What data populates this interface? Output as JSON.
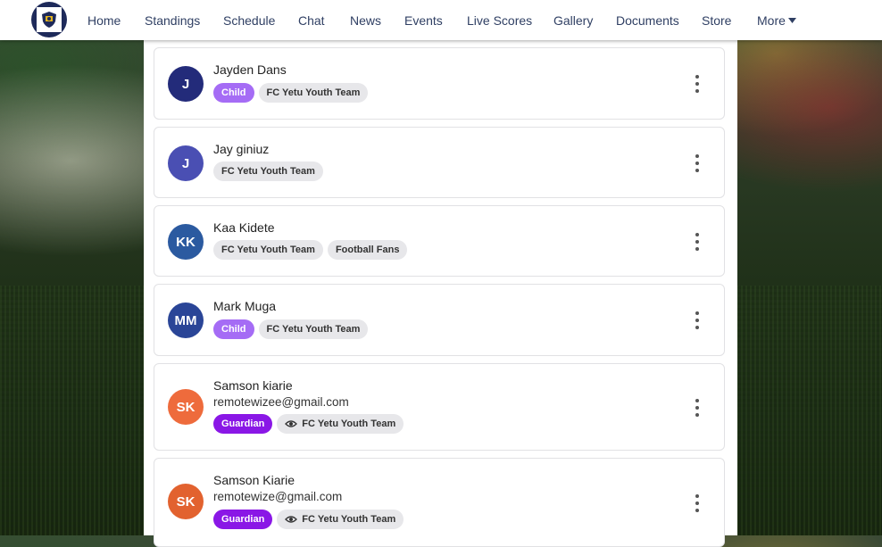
{
  "nav": {
    "items": [
      "Home",
      "Standings",
      "Schedule",
      "Chat",
      "News",
      "Events",
      "Live Scores",
      "Gallery",
      "Documents",
      "Store",
      "More"
    ],
    "more_icon": "caret-down-icon"
  },
  "members": [
    {
      "initials": "J",
      "name": "Jayden Dans",
      "email": "",
      "avatar_color": "#232b7a",
      "tags": [
        {
          "label": "Child",
          "kind": "child"
        },
        {
          "label": "FC Yetu Youth Team",
          "kind": "team"
        }
      ]
    },
    {
      "initials": "J",
      "name": "Jay giniuz",
      "email": "",
      "avatar_color": "#4a4fb3",
      "tags": [
        {
          "label": "FC Yetu Youth Team",
          "kind": "team"
        }
      ]
    },
    {
      "initials": "KK",
      "name": "Kaa Kidete",
      "email": "",
      "avatar_color": "#2b5aa0",
      "tags": [
        {
          "label": "FC Yetu Youth Team",
          "kind": "team"
        },
        {
          "label": "Football Fans",
          "kind": "team"
        }
      ]
    },
    {
      "initials": "MM",
      "name": "Mark Muga",
      "email": "",
      "avatar_color": "#2a4597",
      "tags": [
        {
          "label": "Child",
          "kind": "child"
        },
        {
          "label": "FC Yetu Youth Team",
          "kind": "team"
        }
      ]
    },
    {
      "initials": "SK",
      "name": "Samson kiarie",
      "email": "remotewizee@gmail.com",
      "avatar_color": "#ee6b3c",
      "tags": [
        {
          "label": "Guardian",
          "kind": "guardian"
        },
        {
          "label": "FC Yetu Youth Team",
          "kind": "team-eye"
        }
      ]
    },
    {
      "initials": "SK",
      "name": "Samson Kiarie",
      "email": "remotewize@gmail.com",
      "avatar_color": "#e2622f",
      "tags": [
        {
          "label": "Guardian",
          "kind": "guardian"
        },
        {
          "label": "FC Yetu Youth Team",
          "kind": "team-eye"
        }
      ]
    }
  ]
}
